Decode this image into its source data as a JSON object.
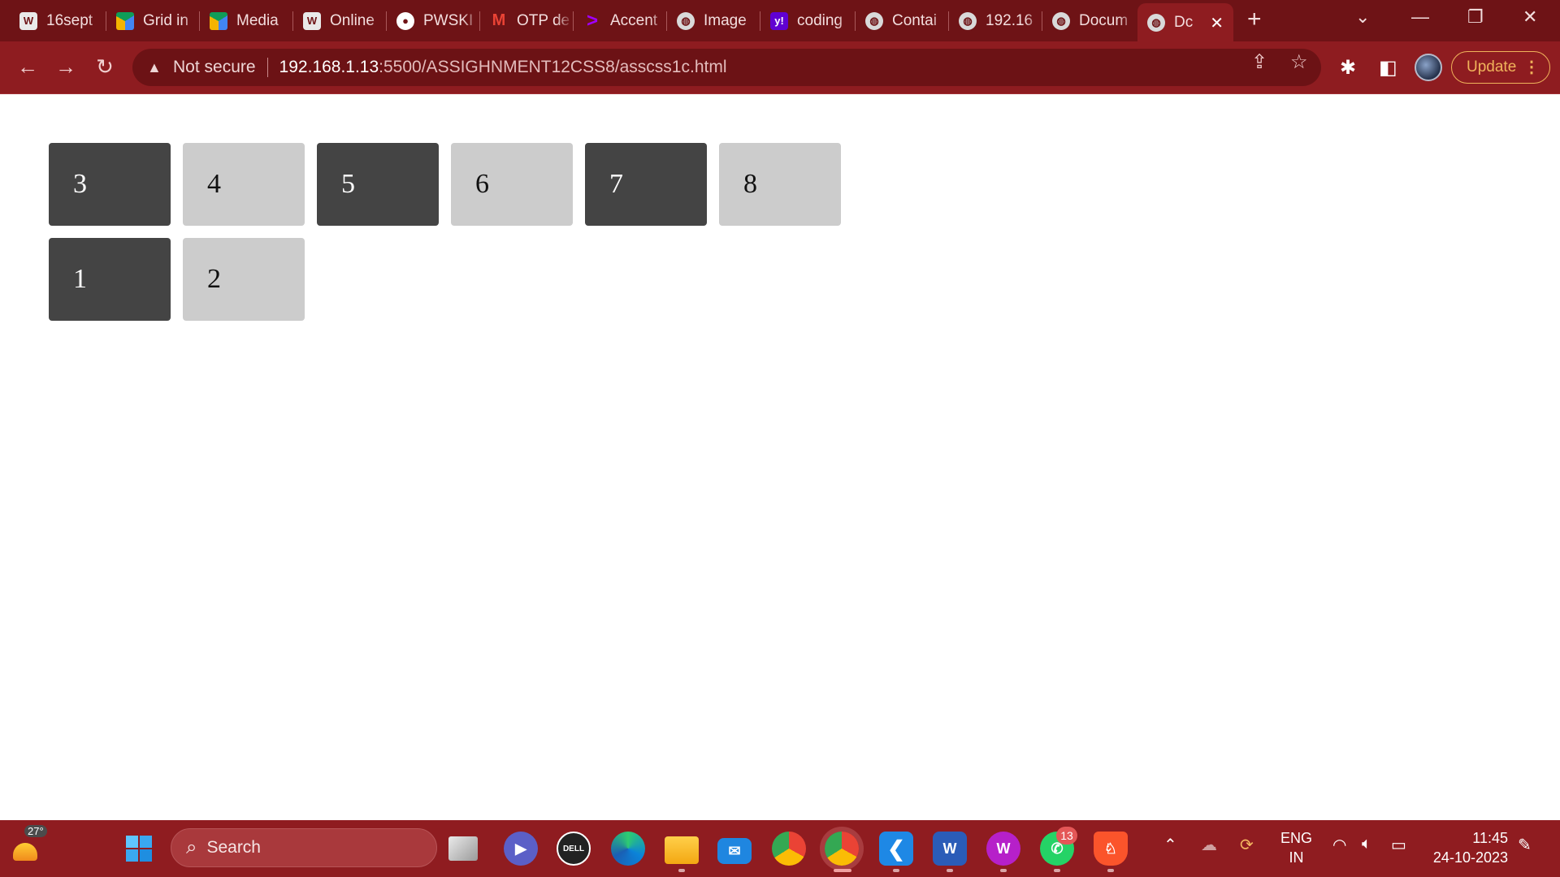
{
  "browser": {
    "tabs": [
      {
        "title": "16sept",
        "icon": "wordpress-icon"
      },
      {
        "title": "Grid in",
        "icon": "google-drive-icon"
      },
      {
        "title": "Media",
        "icon": "google-drive-icon"
      },
      {
        "title": "Online",
        "icon": "wordpress-icon"
      },
      {
        "title": "PWSKI",
        "icon": "github-icon"
      },
      {
        "title": "OTP de",
        "icon": "gmail-icon"
      },
      {
        "title": "Accent",
        "icon": "accenture-icon"
      },
      {
        "title": "Image",
        "icon": "globe-icon"
      },
      {
        "title": "coding",
        "icon": "yahoo-icon"
      },
      {
        "title": "Contai",
        "icon": "globe-icon"
      },
      {
        "title": "192.16",
        "icon": "globe-icon"
      },
      {
        "title": "Docum",
        "icon": "globe-icon"
      },
      {
        "title": "Dc",
        "icon": "globe-icon",
        "active": true
      }
    ],
    "security_label": "Not secure",
    "url_host": "192.168.1.13",
    "url_path": ":5500/ASSIGHNMENT12CSS8/asscss1c.html",
    "update_label": "Update",
    "colors": {
      "frame": "#6e1316",
      "toolbar": "#8e1c20",
      "update_accent": "#f0b35b"
    }
  },
  "page": {
    "boxes": [
      {
        "label": "3",
        "tone": "dark"
      },
      {
        "label": "4",
        "tone": "light"
      },
      {
        "label": "5",
        "tone": "dark"
      },
      {
        "label": "6",
        "tone": "light"
      },
      {
        "label": "7",
        "tone": "dark"
      },
      {
        "label": "8",
        "tone": "light"
      },
      {
        "label": "1",
        "tone": "dark"
      },
      {
        "label": "2",
        "tone": "light"
      }
    ],
    "colors": {
      "dark_box": "#444444",
      "light_box": "#cccccc"
    }
  },
  "taskbar": {
    "weather_temp": "27°",
    "search_placeholder": "Search",
    "whatsapp_badge": "13",
    "lang_line1": "ENG",
    "lang_line2": "IN",
    "time": "11:45",
    "date": "24-10-2023",
    "colors": {
      "background": "#8f1c20"
    }
  }
}
